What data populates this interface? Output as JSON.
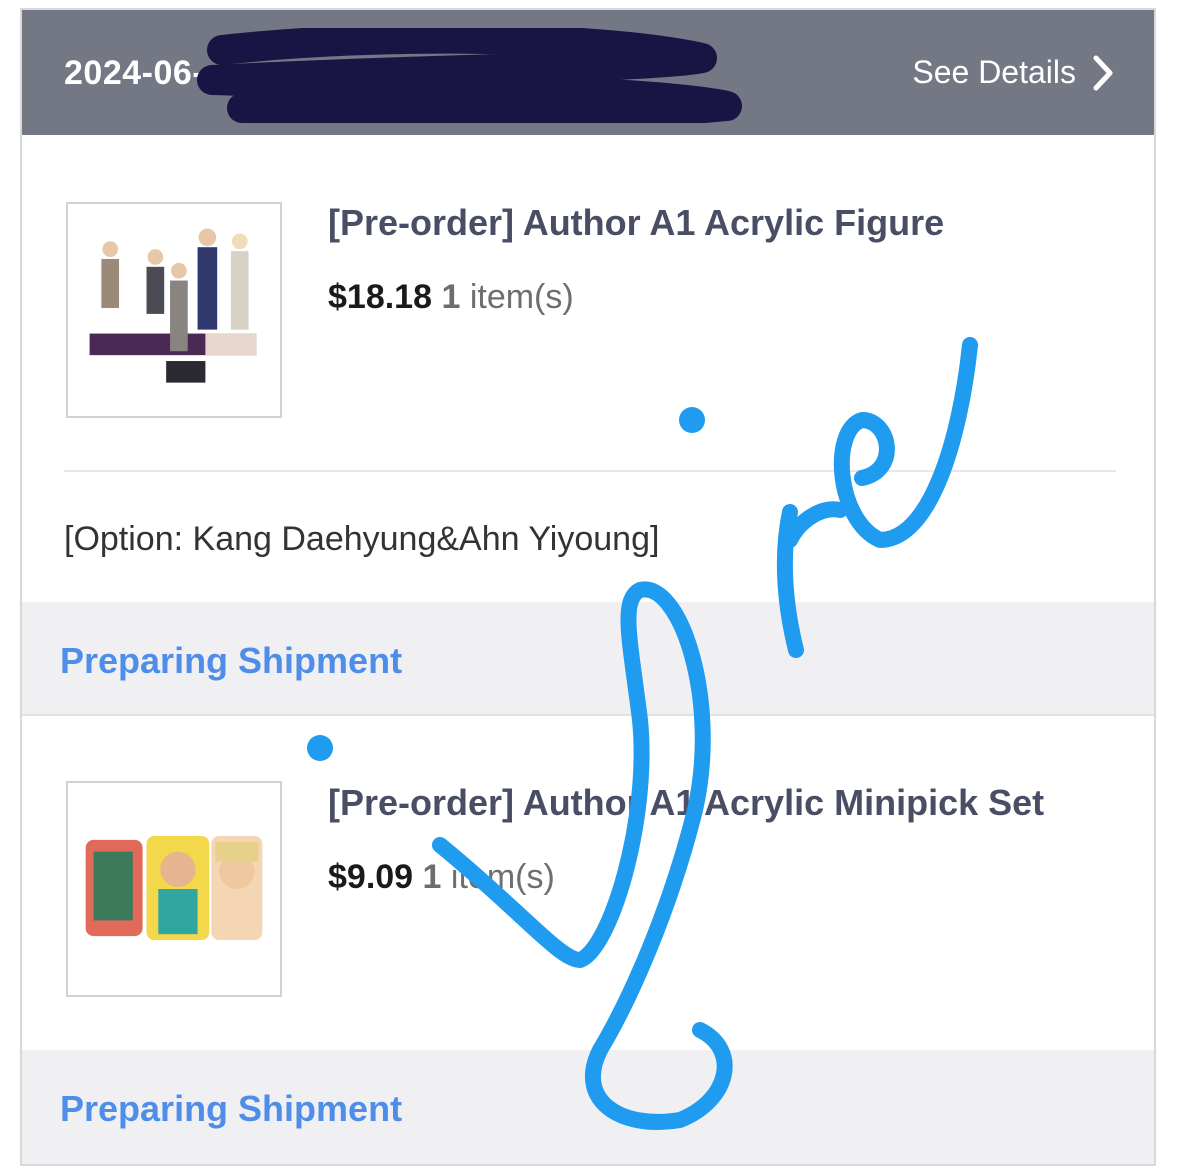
{
  "header": {
    "date": "2024-06-",
    "details_label": "See Details"
  },
  "orders": [
    {
      "title": "[Pre-order] Author A1 Acrylic Figure",
      "price": "$18.18",
      "qty": "1",
      "qty_label": "item(s)",
      "option": "[Option: Kang Daehyung&Ahn Yiyoung]",
      "status": "Preparing Shipment"
    },
    {
      "title": "[Pre-order] Author A1 Acrylic Minipick Set",
      "price": "$9.09",
      "qty": "1",
      "qty_label": "item(s)",
      "status": "Preparing Shipment"
    }
  ],
  "colors": {
    "header_bg": "#747784",
    "status_text": "#4e8ee8",
    "title_text": "#4a4e64",
    "signature": "#1f9bf0",
    "redaction": "#1a1445"
  }
}
